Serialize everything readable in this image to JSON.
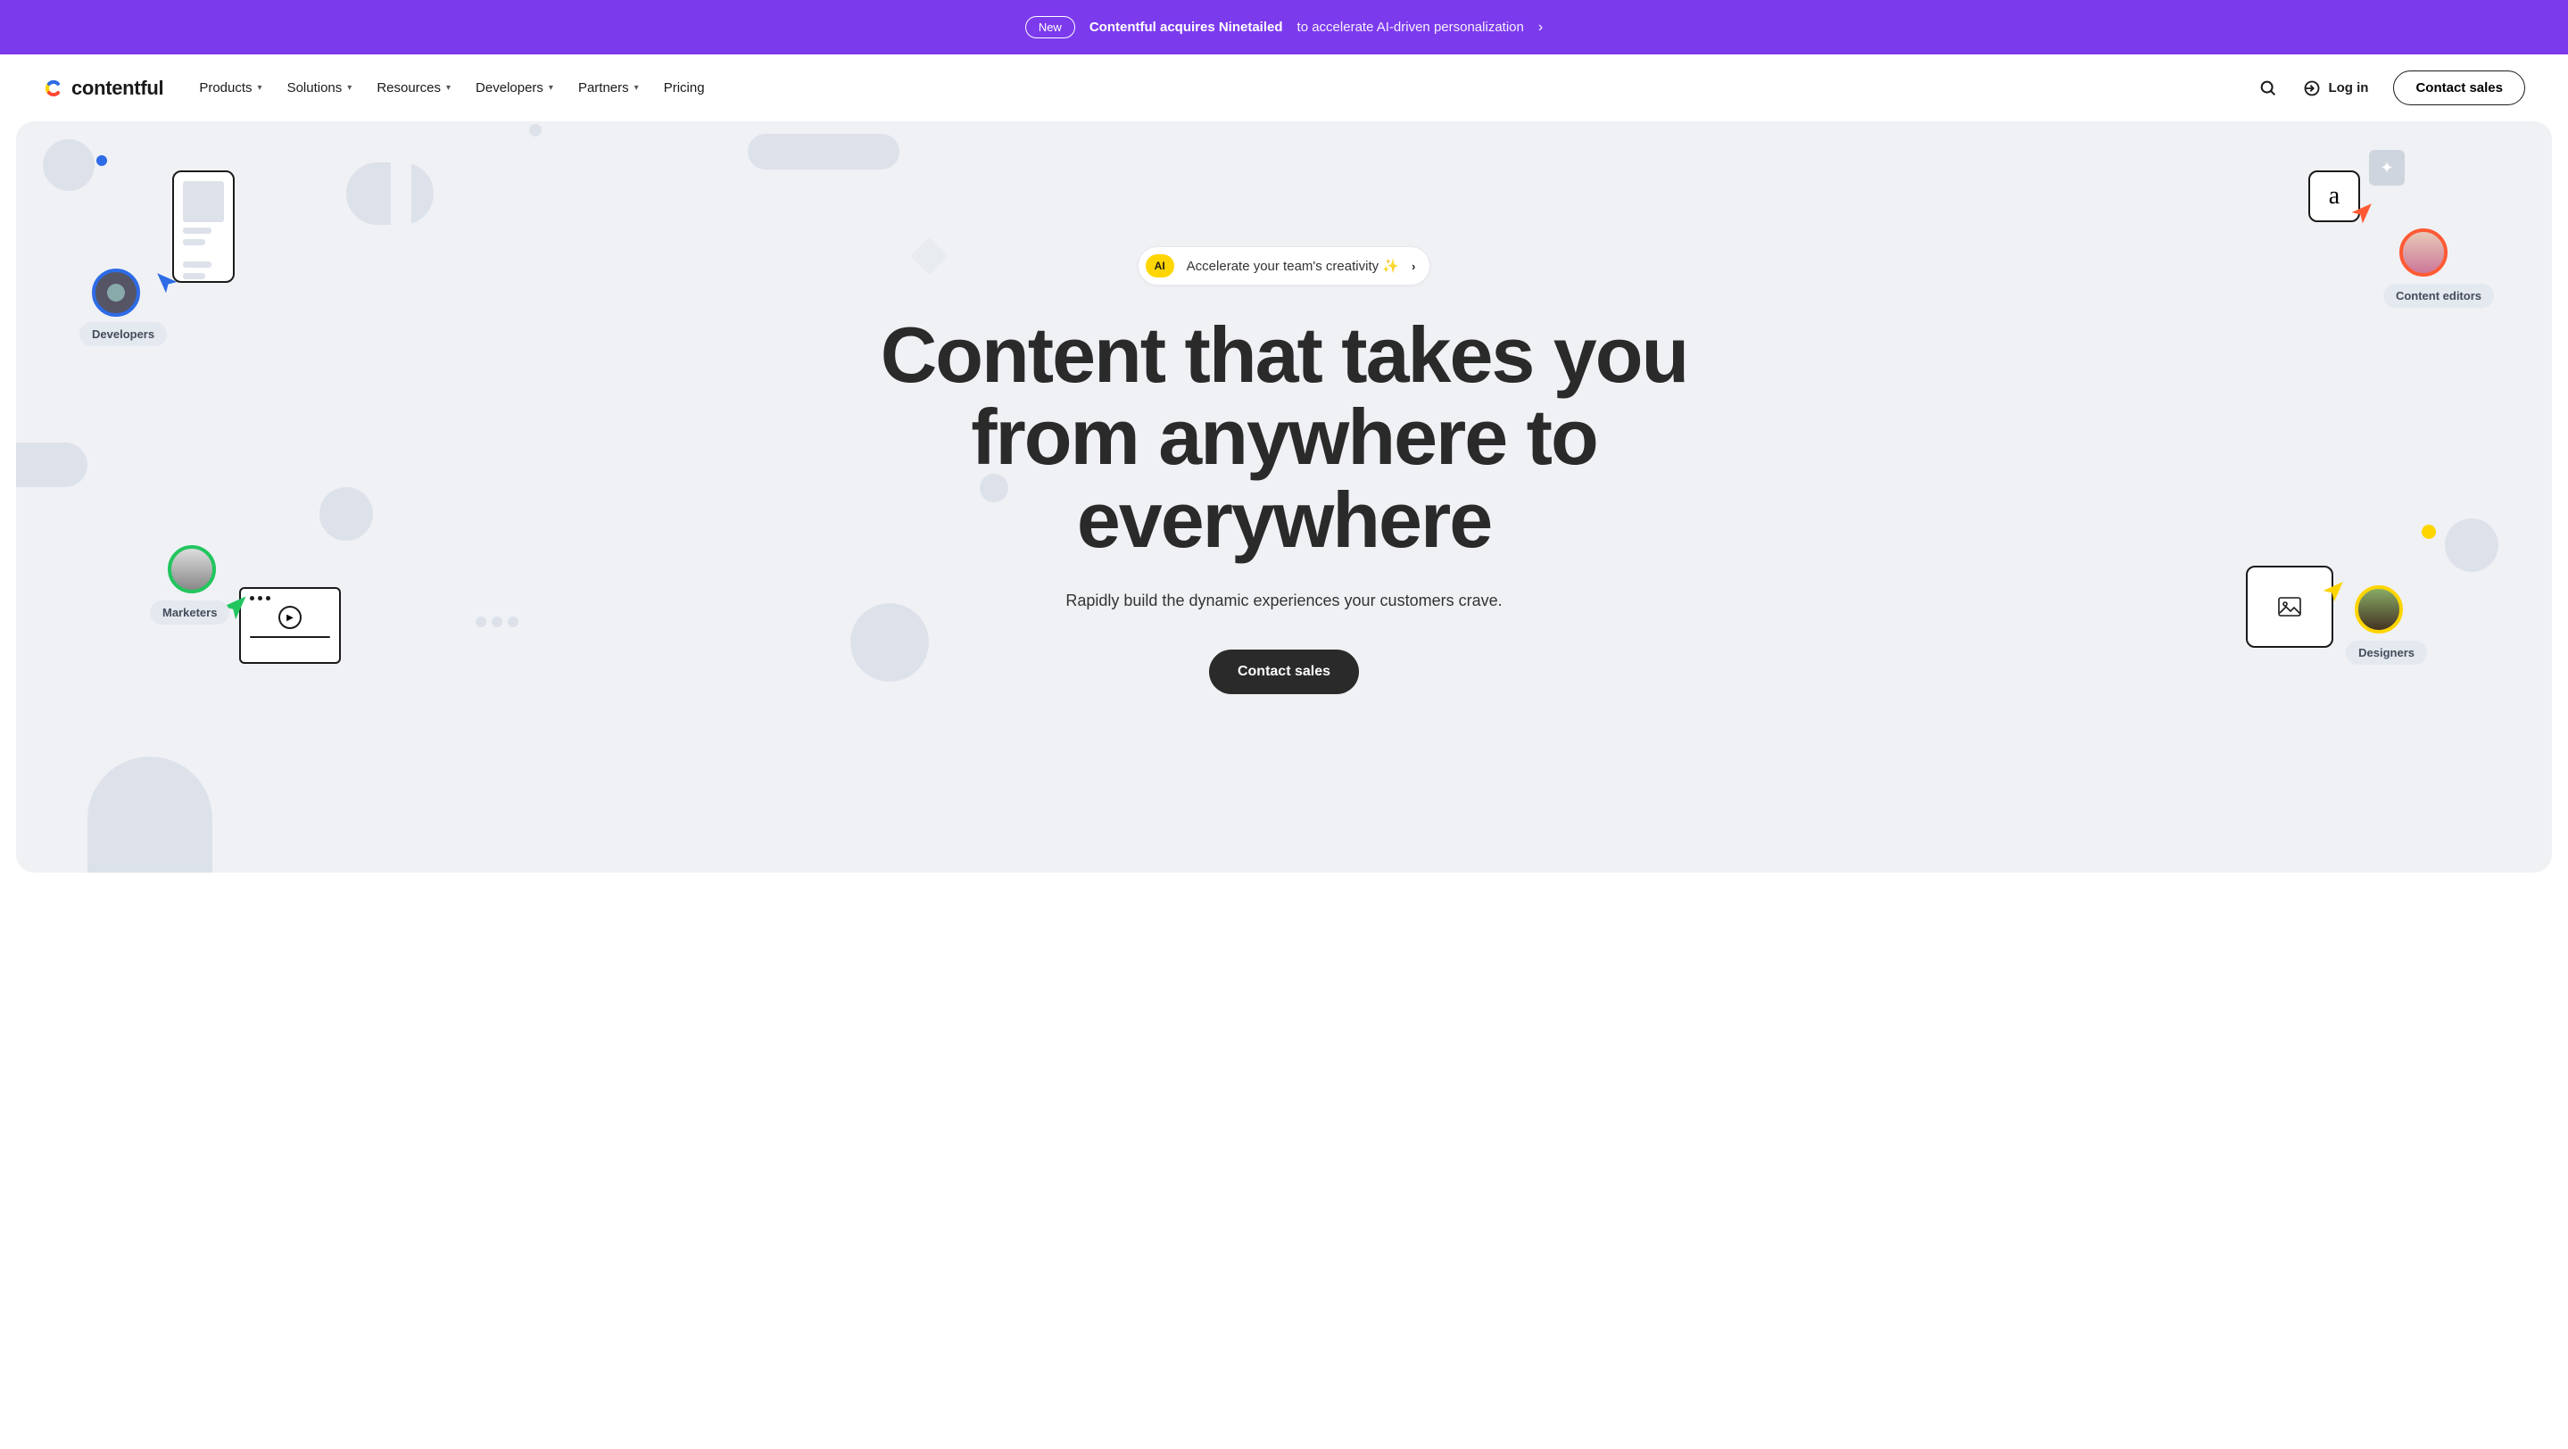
{
  "announcement": {
    "badge": "New",
    "headline": "Contentful acquires Ninetailed",
    "sub": "to accelerate AI-driven personalization"
  },
  "brand": "contentful",
  "nav": {
    "items": [
      "Products",
      "Solutions",
      "Resources",
      "Developers",
      "Partners",
      "Pricing"
    ]
  },
  "login_label": "Log in",
  "contact_sales_label": "Contact sales",
  "ai_pill": {
    "badge": "AI",
    "text": "Accelerate your team's creativity ✨"
  },
  "hero": {
    "heading": "Content that takes you from anywhere to everywhere",
    "sub": "Rapidly build the dynamic experiences your customers crave.",
    "cta": "Contact sales"
  },
  "personas": {
    "developers": "Developers",
    "editors": "Content editors",
    "marketers": "Marketers",
    "designers": "Designers"
  },
  "letter_card": "a",
  "colors": {
    "accent_purple": "#7c3aed",
    "accent_yellow": "#ffd500",
    "blue": "#2e6be6",
    "orange": "#ff5a33",
    "green": "#22c55e"
  }
}
